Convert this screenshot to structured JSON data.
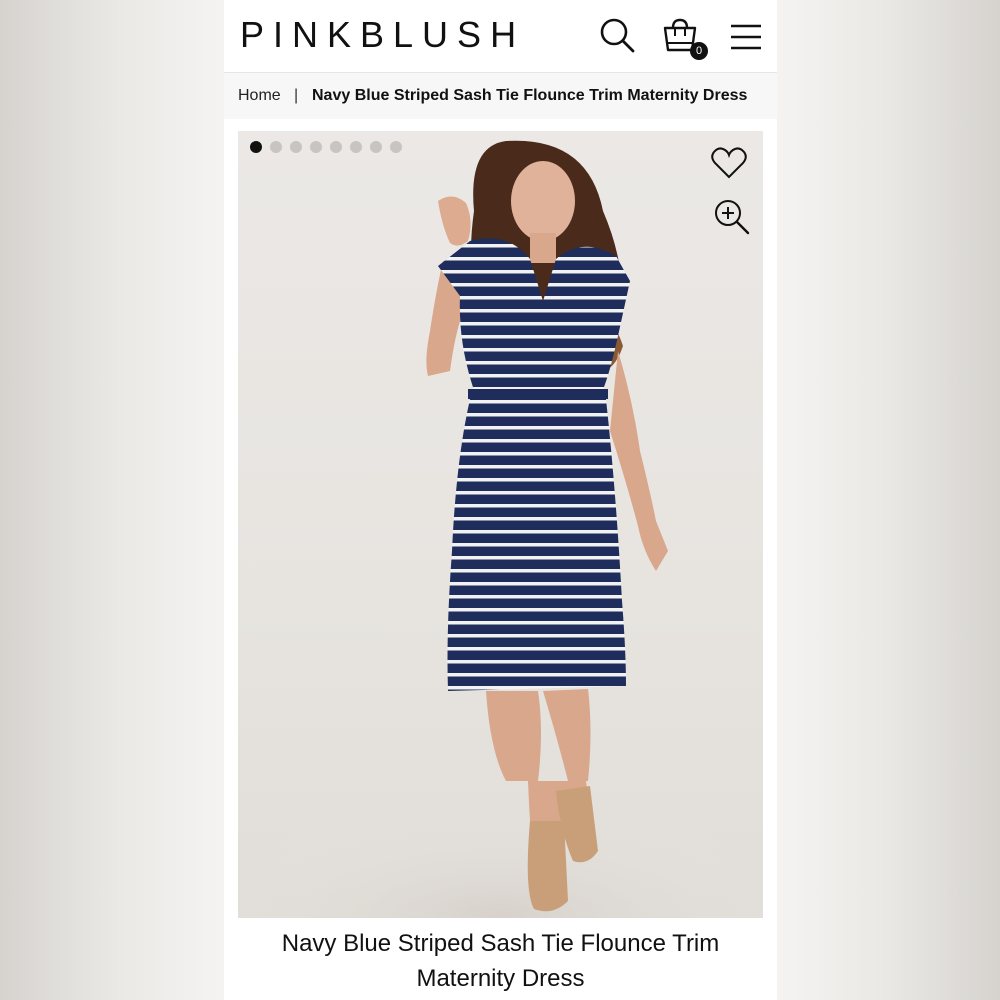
{
  "header": {
    "logo": "PINKBLUSH",
    "search_icon": "search-icon",
    "cart_icon": "shopping-bag-icon",
    "cart_count": "0",
    "menu_icon": "hamburger-menu-icon"
  },
  "breadcrumb": {
    "home": "Home",
    "separator": "|",
    "current": "Navy Blue Striped Sash Tie Flounce Trim Maternity Dress"
  },
  "gallery": {
    "image_count": 8,
    "active_index": 0,
    "wishlist_icon": "heart-icon",
    "zoom_icon": "zoom-in-icon"
  },
  "product": {
    "title_line1": "Navy Blue Striped Sash Tie Flounce Trim",
    "title_line2": "Maternity Dress"
  },
  "colors": {
    "dress_navy": "#1f2d5c",
    "stripe_white": "#f2f2f2"
  }
}
